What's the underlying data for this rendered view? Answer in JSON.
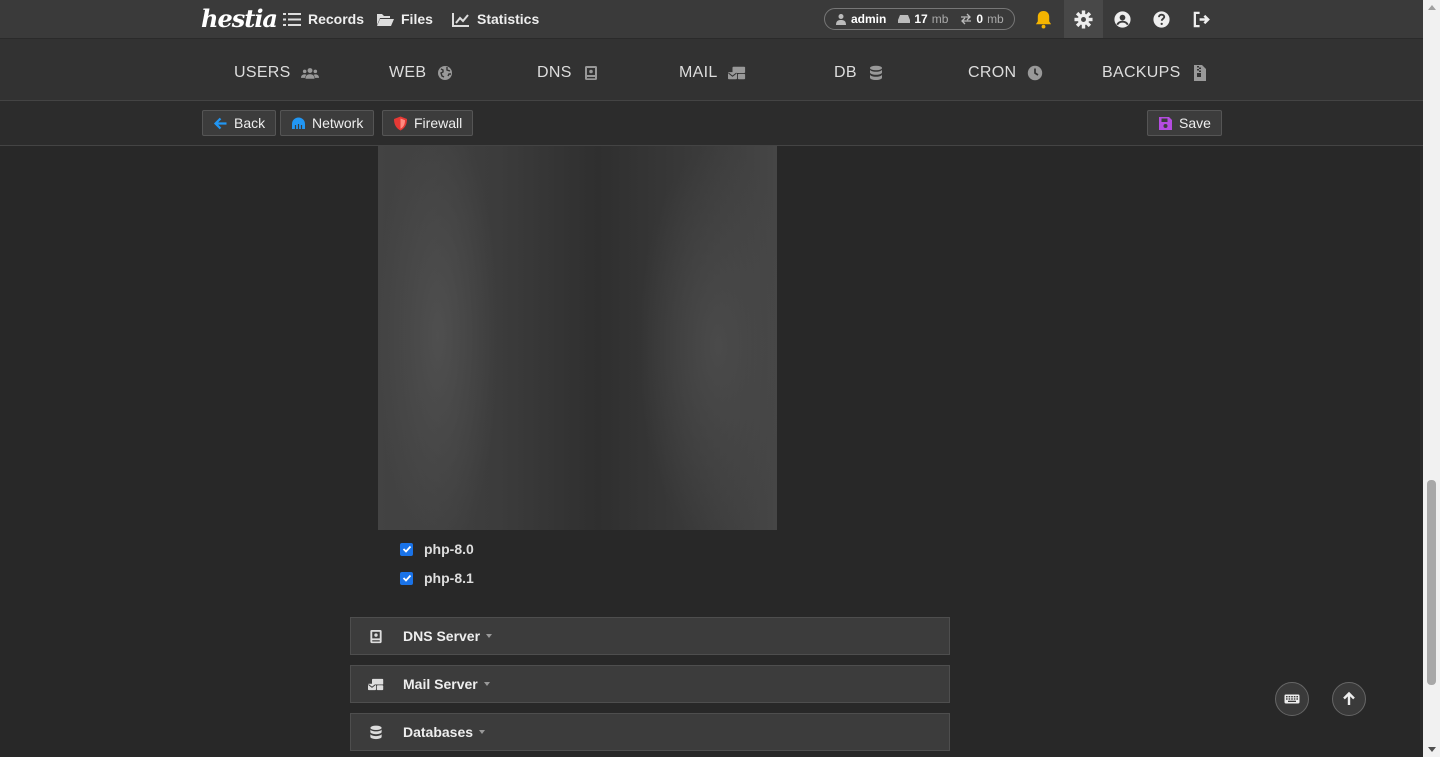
{
  "app": {
    "logo": "hestia"
  },
  "topnav": [
    {
      "label": "Records",
      "icon": "list-icon"
    },
    {
      "label": "Files",
      "icon": "folder-open-icon"
    },
    {
      "label": "Statistics",
      "icon": "chart-line-icon"
    }
  ],
  "user": {
    "name": "admin",
    "disk_value": "17",
    "disk_unit": "mb",
    "bandwidth_value": "0",
    "bandwidth_unit": "mb"
  },
  "topicons": [
    "bell-icon",
    "gear-icon",
    "user-circle-icon",
    "help-icon",
    "logout-icon"
  ],
  "mainmenu": [
    {
      "label": "USERS",
      "icon": "users-icon"
    },
    {
      "label": "WEB",
      "icon": "globe-icon"
    },
    {
      "label": "DNS",
      "icon": "book-icon"
    },
    {
      "label": "MAIL",
      "icon": "mail-bulk-icon"
    },
    {
      "label": "DB",
      "icon": "database-icon"
    },
    {
      "label": "CRON",
      "icon": "clock-icon"
    },
    {
      "label": "BACKUPS",
      "icon": "file-zipper-icon"
    }
  ],
  "toolbar": {
    "back_label": "Back",
    "network_label": "Network",
    "firewall_label": "Firewall",
    "save_label": "Save"
  },
  "php_versions": [
    {
      "label": "php-8.0",
      "checked": true
    },
    {
      "label": "php-8.1",
      "checked": true
    }
  ],
  "sections": [
    {
      "label": "DNS Server",
      "icon": "book-icon"
    },
    {
      "label": "Mail Server",
      "icon": "mail-bulk-icon"
    },
    {
      "label": "Databases",
      "icon": "database-icon"
    }
  ],
  "colors": {
    "accent": "#1a73e8",
    "bell": "#f4b400",
    "firewall": "#e53935",
    "save": "#b44ce0",
    "network": "#2196f3"
  }
}
